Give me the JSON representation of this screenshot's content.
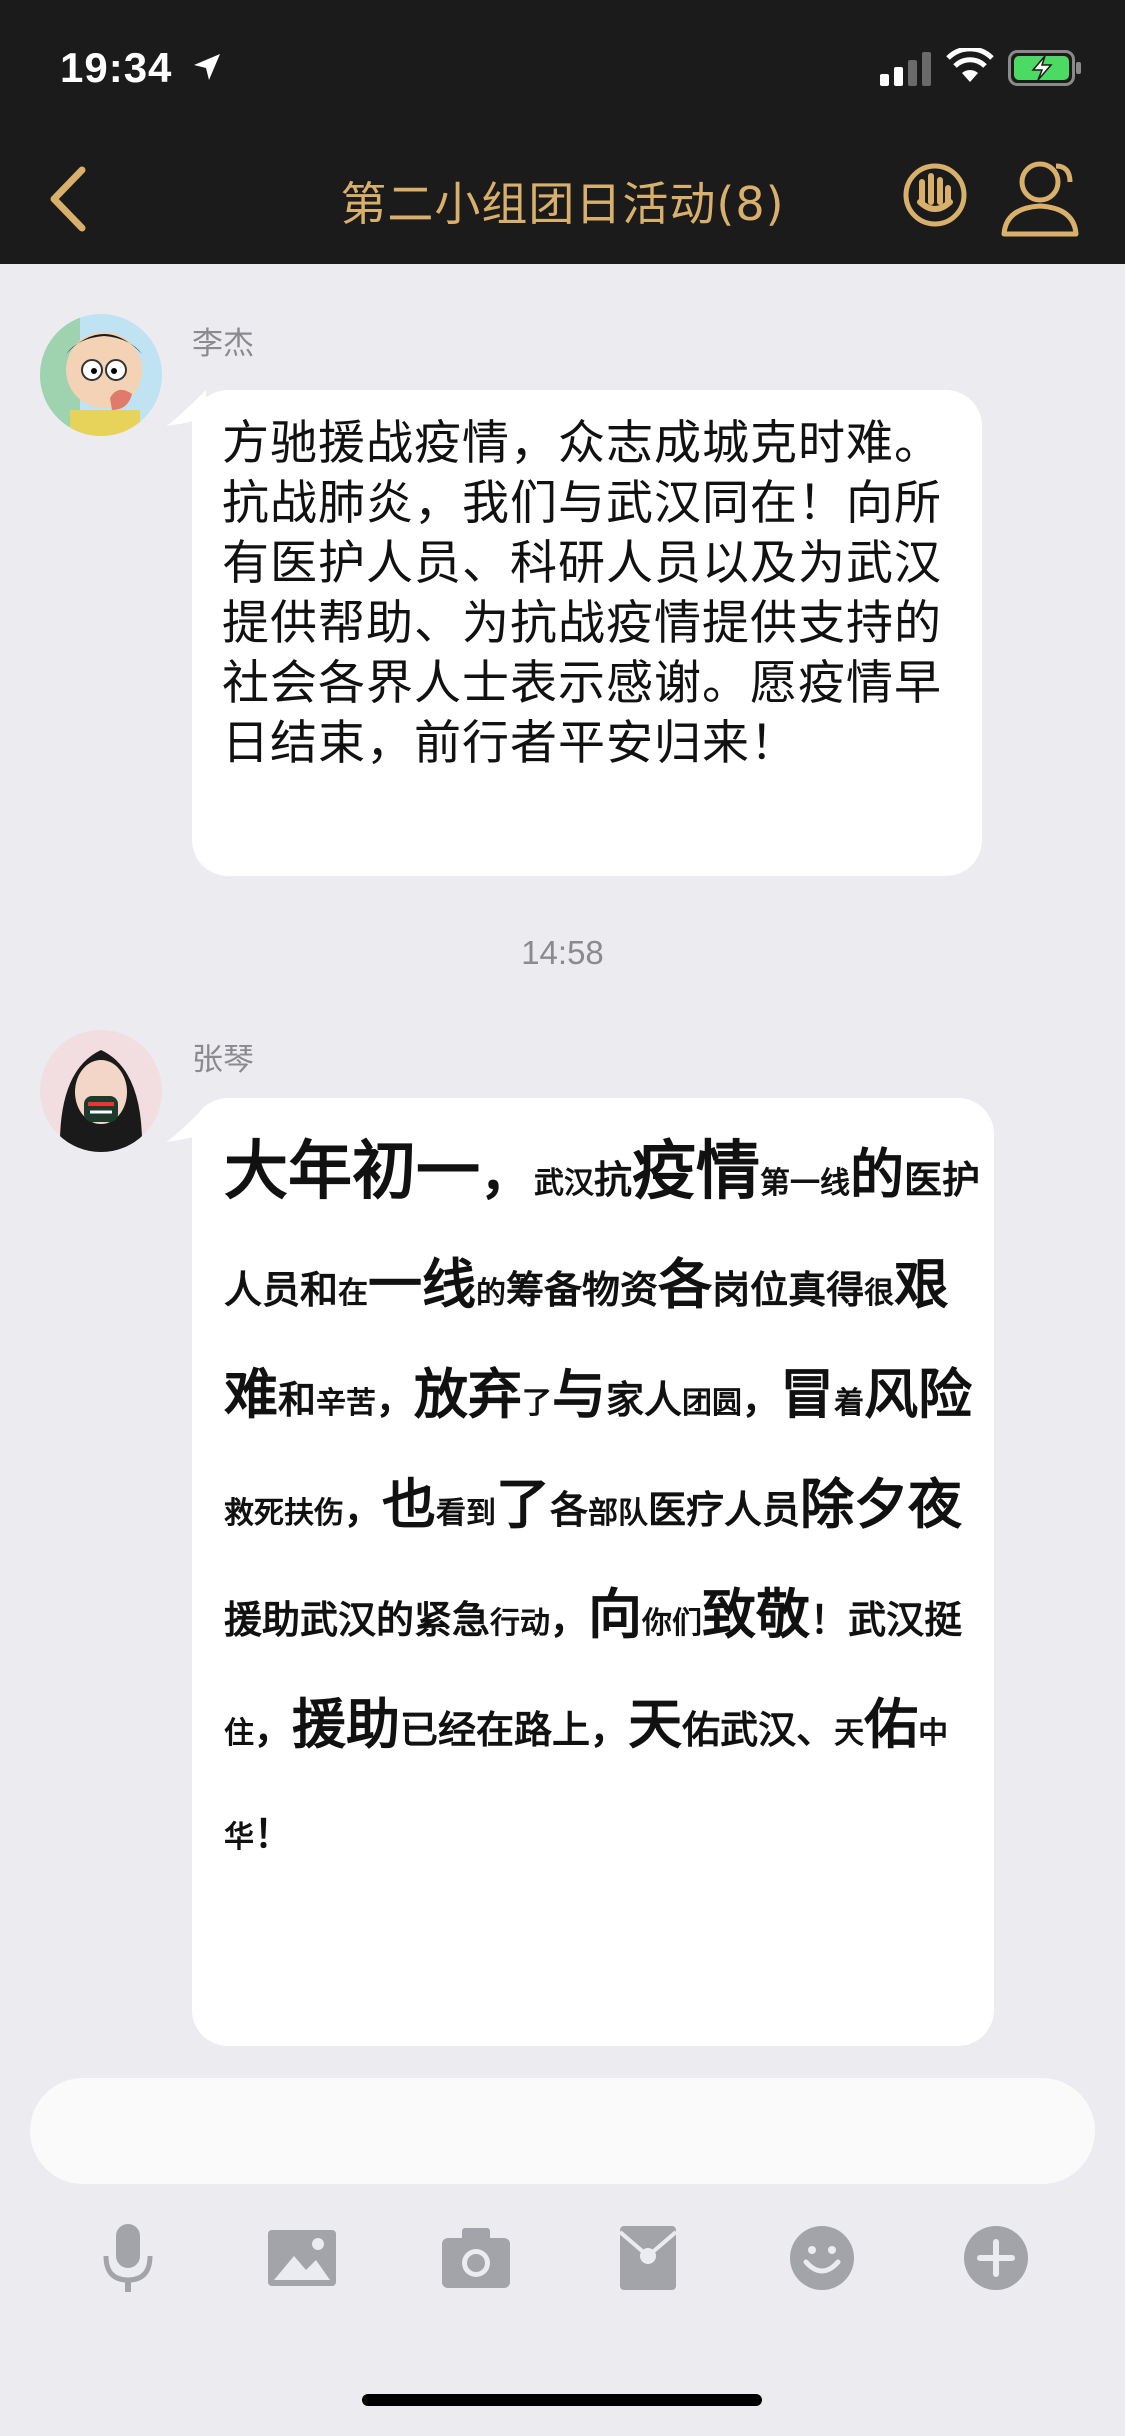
{
  "status_bar": {
    "time": "19:34"
  },
  "nav": {
    "title": "第二小组团日活动(8)"
  },
  "messages": [
    {
      "sender": "李杰",
      "text": "方驰援战疫情，众志成城克时难。抗战肺炎，我们与武汉同在！向所有医护人员、科研人员以及为武汉提供帮助、为抗战疫情提供支持的社会各界人士表示感谢。愿疫情早日结束，前行者平安归来！"
    },
    {
      "sender": "张琴",
      "segments": [
        [
          "大年初一",
          "xl"
        ],
        [
          "，",
          "l"
        ],
        [
          "武汉",
          "s"
        ],
        [
          "抗",
          "m"
        ],
        [
          "疫情",
          "xl"
        ],
        [
          "第一",
          "s"
        ],
        [
          "线",
          "s"
        ],
        [
          "的",
          "l"
        ],
        [
          "医护人员",
          "m"
        ],
        [
          "和",
          "m"
        ],
        [
          "在",
          "s"
        ],
        [
          "一线",
          "l"
        ],
        [
          "的",
          "s"
        ],
        [
          "筹备",
          "m"
        ],
        [
          "物资",
          "m"
        ],
        [
          "各",
          "l"
        ],
        [
          "岗位真得",
          "m"
        ],
        [
          "很",
          "s"
        ],
        [
          "艰难",
          "l"
        ],
        [
          "和",
          "m"
        ],
        [
          "辛",
          "s"
        ],
        [
          "苦",
          "s"
        ],
        [
          "，",
          "m"
        ],
        [
          "放弃",
          "l"
        ],
        [
          "了",
          "s"
        ],
        [
          "与",
          "l"
        ],
        [
          "家人",
          "m"
        ],
        [
          "团圆",
          "s"
        ],
        [
          "，",
          "m"
        ],
        [
          "冒",
          "l"
        ],
        [
          "着",
          "s"
        ],
        [
          "风险",
          "l"
        ],
        [
          "救死扶伤",
          "s"
        ],
        [
          "，",
          "m"
        ],
        [
          "也",
          "l"
        ],
        [
          "看到",
          "s"
        ],
        [
          "了",
          "l"
        ],
        [
          "各",
          "m"
        ],
        [
          "部队",
          "s"
        ],
        [
          "医疗人员",
          "m"
        ],
        [
          "除夕夜",
          "l"
        ],
        [
          "援助武汉的紧",
          "m"
        ],
        [
          "急",
          "m"
        ],
        [
          "行动",
          "s"
        ],
        [
          "，",
          "m"
        ],
        [
          "向",
          "l"
        ],
        [
          "你们",
          "s"
        ],
        [
          "致敬",
          "l"
        ],
        [
          "！",
          "m"
        ],
        [
          "武汉挺",
          "m"
        ],
        [
          "住",
          "s"
        ],
        [
          "，",
          "m"
        ],
        [
          "援助",
          "l"
        ],
        [
          "已经",
          "m"
        ],
        [
          "在路上",
          "m"
        ],
        [
          "，",
          "m"
        ],
        [
          "天",
          "l"
        ],
        [
          "佑武",
          "m"
        ],
        [
          "汉、",
          "m"
        ],
        [
          "天",
          "s"
        ],
        [
          "佑",
          "l"
        ],
        [
          "中华",
          "s"
        ],
        [
          "！",
          "m"
        ]
      ]
    }
  ],
  "time_separator": "14:58",
  "toolbar": [
    "microphone-icon",
    "image-icon",
    "camera-icon",
    "red-packet-icon",
    "emoji-icon",
    "plus-icon"
  ],
  "colors": {
    "nav_bg": "#1b1b1b",
    "accent_gold": "#d8b06b",
    "chat_bg": "#ebebf0",
    "icon_gray": "#a3a3aa"
  }
}
